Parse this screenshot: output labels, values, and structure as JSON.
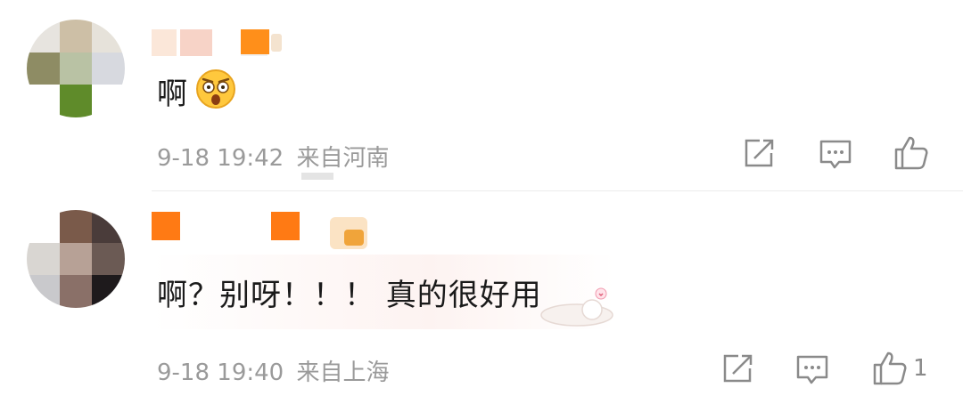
{
  "comments": [
    {
      "text": "啊",
      "date": "9-18",
      "time": "19:42",
      "location": "来自河南",
      "emoji": "shocked-face-emoji",
      "likes": ""
    },
    {
      "text": "啊？别呀！！！ 真的很好用",
      "date": "9-18",
      "time": "19:40",
      "location": "来自上海",
      "emoji": "",
      "likes": "1"
    }
  ],
  "icons": {
    "share": "share-icon",
    "reply": "comment-icon",
    "like": "thumbs-up-icon"
  },
  "colors": {
    "accent": "#ff7a14",
    "meta": "#9a9a9a",
    "icon": "#8a8a8a"
  }
}
